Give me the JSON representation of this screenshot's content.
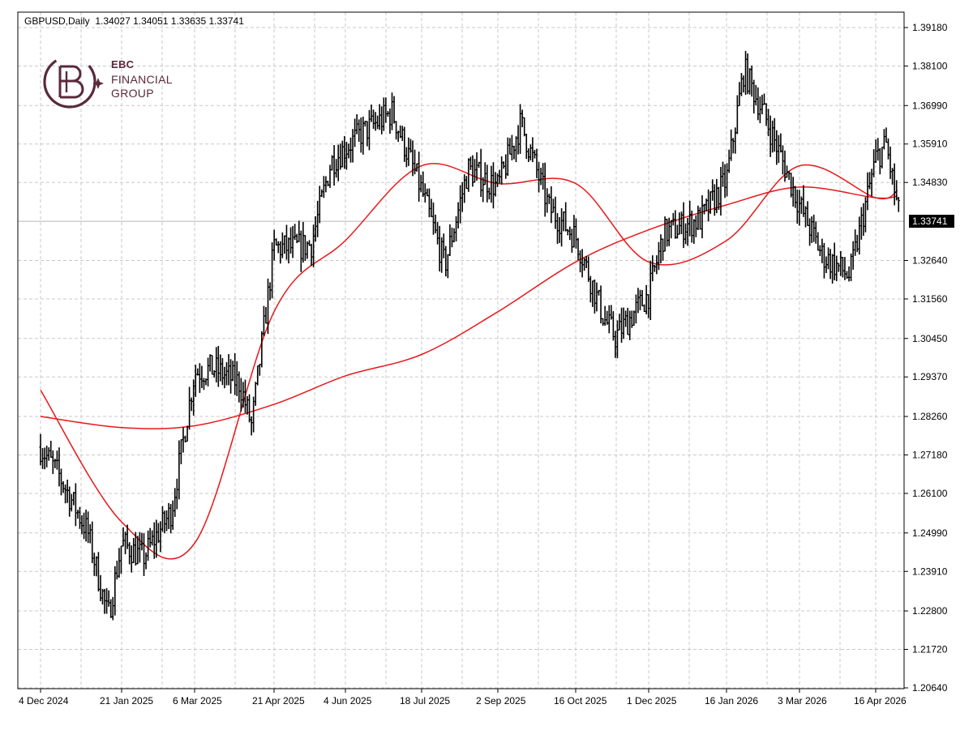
{
  "header": {
    "symbol": "GBPUSD,Daily",
    "ohlc": "1.34027 1.34051 1.33635 1.33741"
  },
  "logo": {
    "line1": "EBC",
    "line2": "FINANCIAL",
    "line3": "GROUP"
  },
  "colors": {
    "background": "#ffffff",
    "bars": "#000000",
    "grid": "#c8c8c8",
    "moving_averages": "#e8171a",
    "last_price_tag": "#000000",
    "logo": "#5a2a3a"
  },
  "chart_data": {
    "type": "line",
    "title": "GBPUSD,Daily",
    "bar_style": "OHLC bars",
    "last_price": "1.33741",
    "ylim": [
      1.2064,
      1.3918
    ],
    "y_ticks": [
      "1.39180",
      "1.38100",
      "1.36990",
      "1.35910",
      "1.34830",
      "1.33741",
      "1.32640",
      "1.31560",
      "1.30450",
      "1.29370",
      "1.28260",
      "1.27180",
      "1.26100",
      "1.24990",
      "1.23910",
      "1.22800",
      "1.21720",
      "1.20640"
    ],
    "x_ticks": [
      "4 Dec 2024",
      "21 Jan 2025",
      "6 Mar 2025",
      "21 Apr 2025",
      "4 Jun 2025",
      "18 Jul 2025",
      "2 Sep 2025",
      "16 Oct 2025",
      "1 Dec 2025",
      "16 Jan 2026",
      "3 Mar 2026",
      "16 Apr 2026"
    ],
    "grid": true,
    "series": [
      {
        "kind": "price",
        "x": [
          "4 Dec 2024",
          "15 Dec 2024",
          "1 Jan 2025",
          "13 Jan 2025",
          "21 Jan 2025",
          "3 Feb 2025",
          "20 Feb 2025",
          "6 Mar 2025",
          "17 Mar 2025",
          "1 Apr 2025",
          "8 Apr 2025",
          "21 Apr 2025",
          "5 May 2025",
          "14 May 2025",
          "26 May 2025",
          "4 Jun 2025",
          "13 Jun 2025",
          "1 Jul 2025",
          "18 Jul 2025",
          "1 Aug 2025",
          "15 Aug 2025",
          "2 Sep 2025",
          "15 Sep 2025",
          "1 Oct 2025",
          "16 Oct 2025",
          "3 Nov 2025",
          "10 Nov 2025",
          "1 Dec 2025",
          "10 Dec 2025",
          "1 Jan 2026",
          "16 Jan 2026",
          "27 Jan 2026",
          "10 Feb 2026",
          "3 Mar 2026",
          "16 Mar 2026",
          "1 Apr 2026",
          "16 Apr 2026",
          "22 Apr 2026",
          "30 Apr 2026"
        ],
        "y": [
          1.274,
          1.266,
          1.25,
          1.226,
          1.247,
          1.243,
          1.256,
          1.295,
          1.296,
          1.292,
          1.28,
          1.33,
          1.33,
          1.331,
          1.354,
          1.358,
          1.362,
          1.368,
          1.346,
          1.325,
          1.352,
          1.347,
          1.365,
          1.341,
          1.333,
          1.31,
          1.305,
          1.317,
          1.334,
          1.338,
          1.349,
          1.38,
          1.366,
          1.342,
          1.328,
          1.322,
          1.355,
          1.359,
          1.3374
        ]
      },
      {
        "kind": "moving-average-fast",
        "x": [
          "4 Dec 2024",
          "21 Jan 2025",
          "6 Mar 2025",
          "21 Apr 2025",
          "4 Jun 2025",
          "18 Jul 2025",
          "2 Sep 2025",
          "16 Oct 2025",
          "1 Dec 2025",
          "16 Jan 2026",
          "3 Mar 2026",
          "16 Apr 2026",
          "30 Apr 2026"
        ],
        "y": [
          1.29,
          1.253,
          1.247,
          1.312,
          1.332,
          1.353,
          1.348,
          1.348,
          1.326,
          1.332,
          1.353,
          1.344,
          1.346
        ]
      },
      {
        "kind": "moving-average-slow",
        "x": [
          "4 Dec 2024",
          "21 Jan 2025",
          "6 Mar 2025",
          "21 Apr 2025",
          "4 Jun 2025",
          "18 Jul 2025",
          "2 Sep 2025",
          "16 Oct 2025",
          "1 Dec 2025",
          "16 Jan 2026",
          "3 Mar 2026",
          "16 Apr 2026",
          "30 Apr 2026"
        ],
        "y": [
          1.2826,
          1.2795,
          1.28,
          1.286,
          1.294,
          1.3,
          1.312,
          1.326,
          1.335,
          1.342,
          1.347,
          1.344,
          1.3445
        ]
      }
    ]
  }
}
